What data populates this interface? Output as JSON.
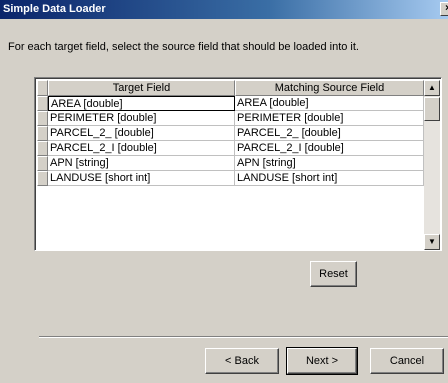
{
  "window": {
    "title": "Simple Data Loader",
    "close_glyph": "×"
  },
  "instruction": "For each target field, select the source field that should be loaded into it.",
  "table": {
    "headers": [
      "Target Field",
      "Matching Source Field"
    ],
    "rows": [
      [
        "AREA [double]",
        "AREA [double]"
      ],
      [
        "PERIMETER [double]",
        "PERIMETER [double]"
      ],
      [
        "PARCEL_2_ [double]",
        "PARCEL_2_ [double]"
      ],
      [
        "PARCEL_2_I [double]",
        "PARCEL_2_I [double]"
      ],
      [
        "APN [string]",
        "APN [string]"
      ],
      [
        "LANDUSE [short int]",
        "LANDUSE [short int]"
      ]
    ]
  },
  "buttons": {
    "reset": "Reset",
    "back": "< Back",
    "next": "Next >",
    "cancel": "Cancel"
  },
  "scrollbar": {
    "up_glyph": "▲",
    "down_glyph": "▼"
  }
}
